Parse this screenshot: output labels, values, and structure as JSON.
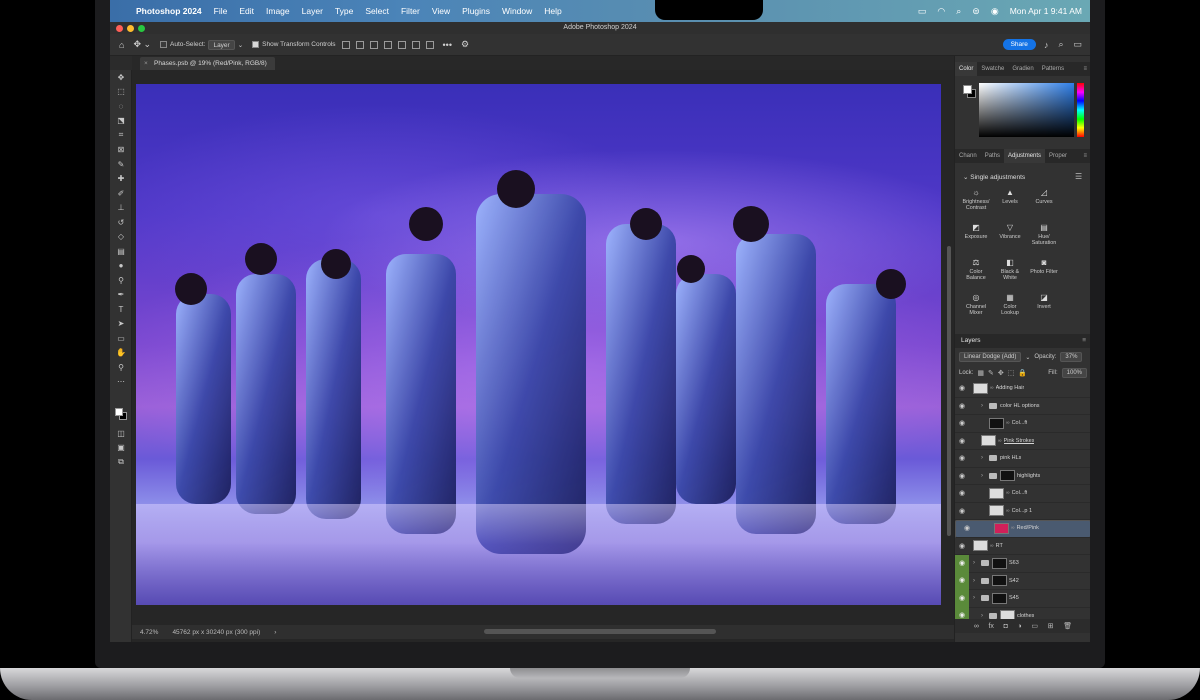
{
  "menubar": {
    "apple_icon": "apple-icon",
    "app_name": "Photoshop 2024",
    "items": [
      "File",
      "Edit",
      "Image",
      "Layer",
      "Type",
      "Select",
      "Filter",
      "View",
      "Plugins",
      "Window",
      "Help"
    ],
    "clock": "Mon Apr 1  9:41 AM"
  },
  "window": {
    "title": "Adobe Photoshop 2024"
  },
  "options": {
    "auto_select_label": "Auto-Select:",
    "auto_select_value": "Layer",
    "transform_label": "Show Transform Controls",
    "share_label": "Share"
  },
  "document": {
    "tab_label": "Phases.psb @ 19% (Red/Pink, RGB/8)",
    "zoom": "4.72%",
    "dimensions": "45762 px x 30240 px (300 ppi)"
  },
  "color_panel": {
    "tabs": [
      "Color",
      "Swatche",
      "Gradien",
      "Patterns"
    ],
    "fg": "#ffffff",
    "bg": "#000000"
  },
  "adjustments_panel": {
    "tabs": [
      "Chann",
      "Paths",
      "Adjustments",
      "Proper"
    ],
    "section": "Single adjustments",
    "items": [
      {
        "label": "Brightness/\nContrast",
        "icon": "sun-icon"
      },
      {
        "label": "Levels",
        "icon": "levels-icon"
      },
      {
        "label": "Curves",
        "icon": "curves-icon"
      },
      {
        "label": "Exposure",
        "icon": "exposure-icon"
      },
      {
        "label": "Vibrance",
        "icon": "vibrance-icon"
      },
      {
        "label": "Hue/\nSaturation",
        "icon": "hue-icon"
      },
      {
        "label": "Color\nBalance",
        "icon": "balance-icon"
      },
      {
        "label": "Black &\nWhite",
        "icon": "bw-icon"
      },
      {
        "label": "Photo Filter",
        "icon": "camera-icon"
      },
      {
        "label": "Channel\nMixer",
        "icon": "mixer-icon"
      },
      {
        "label": "Color\nLookup",
        "icon": "lookup-icon"
      },
      {
        "label": "Invert",
        "icon": "invert-icon"
      }
    ]
  },
  "layers_panel": {
    "title": "Layers",
    "blend_mode": "Linear Dodge (Add)",
    "opacity_label": "Opacity:",
    "opacity_value": "37%",
    "lock_label": "Lock:",
    "fill_label": "Fill:",
    "fill_value": "100%",
    "layers": [
      {
        "name": "Adding Hair",
        "indent": 0,
        "kind": "layer",
        "thumb": "light",
        "green": false,
        "selected": false,
        "underline": false
      },
      {
        "name": "color HL options",
        "indent": 1,
        "kind": "group",
        "thumb": "",
        "green": false,
        "selected": false,
        "underline": false
      },
      {
        "name": "Col...ft",
        "indent": 2,
        "kind": "adj",
        "thumb": "dark",
        "green": false,
        "selected": false,
        "underline": false
      },
      {
        "name": "Pink Strokes",
        "indent": 1,
        "kind": "layer",
        "thumb": "light",
        "green": false,
        "selected": false,
        "underline": true
      },
      {
        "name": "pink HLs",
        "indent": 1,
        "kind": "group",
        "thumb": "",
        "green": false,
        "selected": false,
        "underline": false
      },
      {
        "name": "highlights",
        "indent": 1,
        "kind": "group",
        "thumb": "dark",
        "green": false,
        "selected": false,
        "underline": false
      },
      {
        "name": "Col...ft",
        "indent": 2,
        "kind": "adj",
        "thumb": "light",
        "green": false,
        "selected": false,
        "underline": false
      },
      {
        "name": "Col...p 1",
        "indent": 2,
        "kind": "adj",
        "thumb": "light",
        "green": false,
        "selected": false,
        "underline": false
      },
      {
        "name": "Red/Pink",
        "indent": 2,
        "kind": "layer",
        "thumb": "pink",
        "green": false,
        "selected": true,
        "underline": false
      },
      {
        "name": "RT",
        "indent": 0,
        "kind": "layer",
        "thumb": "light",
        "green": false,
        "selected": false,
        "underline": false
      },
      {
        "name": "S63",
        "indent": 0,
        "kind": "group",
        "thumb": "dark",
        "green": true,
        "selected": false,
        "underline": false
      },
      {
        "name": "S42",
        "indent": 0,
        "kind": "group",
        "thumb": "dark",
        "green": true,
        "selected": false,
        "underline": false
      },
      {
        "name": "S45",
        "indent": 0,
        "kind": "group",
        "thumb": "dark",
        "green": true,
        "selected": false,
        "underline": false
      },
      {
        "name": "clothes",
        "indent": 1,
        "kind": "group",
        "thumb": "light",
        "green": true,
        "selected": false,
        "underline": false
      }
    ]
  }
}
